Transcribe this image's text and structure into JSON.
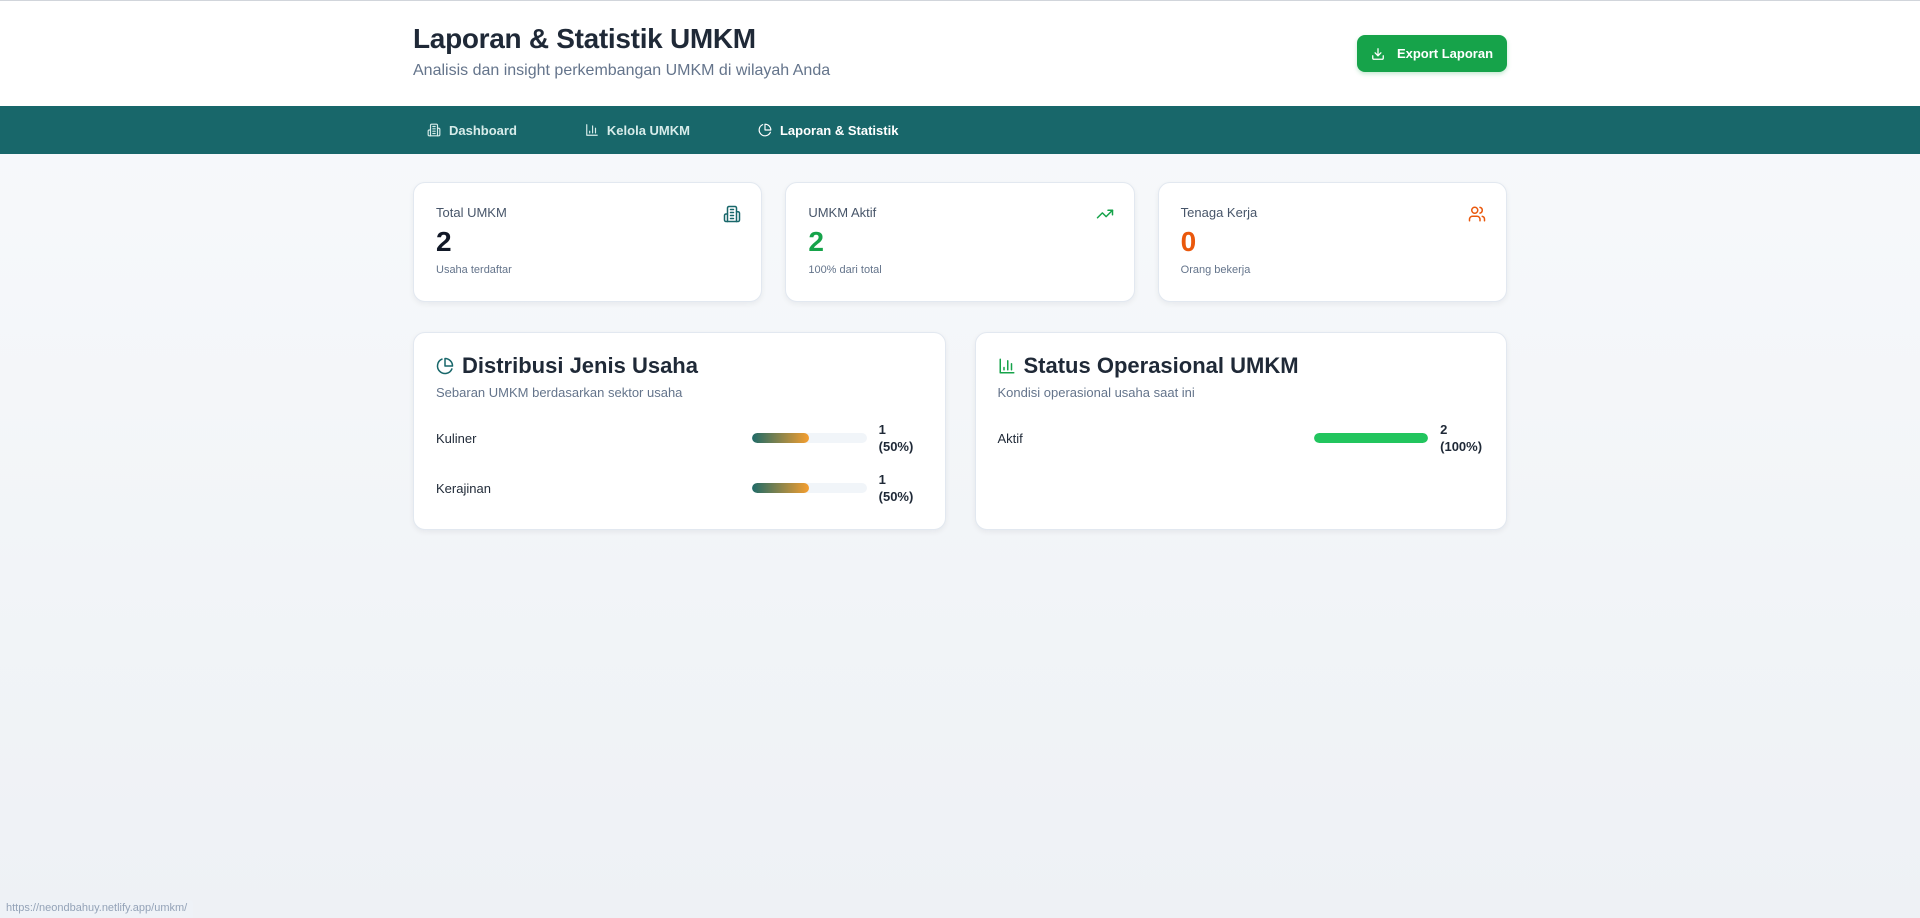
{
  "header": {
    "title": "Laporan & Statistik UMKM",
    "subtitle": "Analisis dan insight perkembangan UMKM di wilayah Anda",
    "export_label": "Export Laporan"
  },
  "nav": {
    "items": [
      {
        "label": "Dashboard",
        "icon": "building-icon"
      },
      {
        "label": "Kelola UMKM",
        "icon": "bar-chart-icon"
      },
      {
        "label": "Laporan & Statistik",
        "icon": "pie-chart-icon",
        "active": true
      }
    ]
  },
  "stats": [
    {
      "label": "Total UMKM",
      "value": "2",
      "note": "Usaha terdaftar",
      "icon": "building-icon",
      "color": "#111827"
    },
    {
      "label": "UMKM Aktif",
      "value": "2",
      "note": "100% dari total",
      "icon": "trending-up-icon",
      "color": "#16a34a"
    },
    {
      "label": "Tenaga Kerja",
      "value": "0",
      "note": "Orang bekerja",
      "icon": "users-icon",
      "color": "#ea580c"
    }
  ],
  "distribution": {
    "title": "Distribusi Jenis Usaha",
    "subtitle": "Sebaran UMKM berdasarkan sektor usaha",
    "rows": [
      {
        "label": "Kuliner",
        "count": "1",
        "percent_text": "(50%)",
        "fraction": 0.5
      },
      {
        "label": "Kerajinan",
        "count": "1",
        "percent_text": "(50%)",
        "fraction": 0.5
      }
    ]
  },
  "status": {
    "title": "Status Operasional UMKM",
    "subtitle": "Kondisi operasional usaha saat ini",
    "rows": [
      {
        "label": "Aktif",
        "count": "2",
        "percent_text": "(100%)",
        "fraction": 1.0
      }
    ]
  },
  "statusbar": {
    "url": "https://neondbahuy.netlify.app/umkm/"
  },
  "colors": {
    "accent": "#18676a",
    "primary_button": "#16a34a"
  }
}
